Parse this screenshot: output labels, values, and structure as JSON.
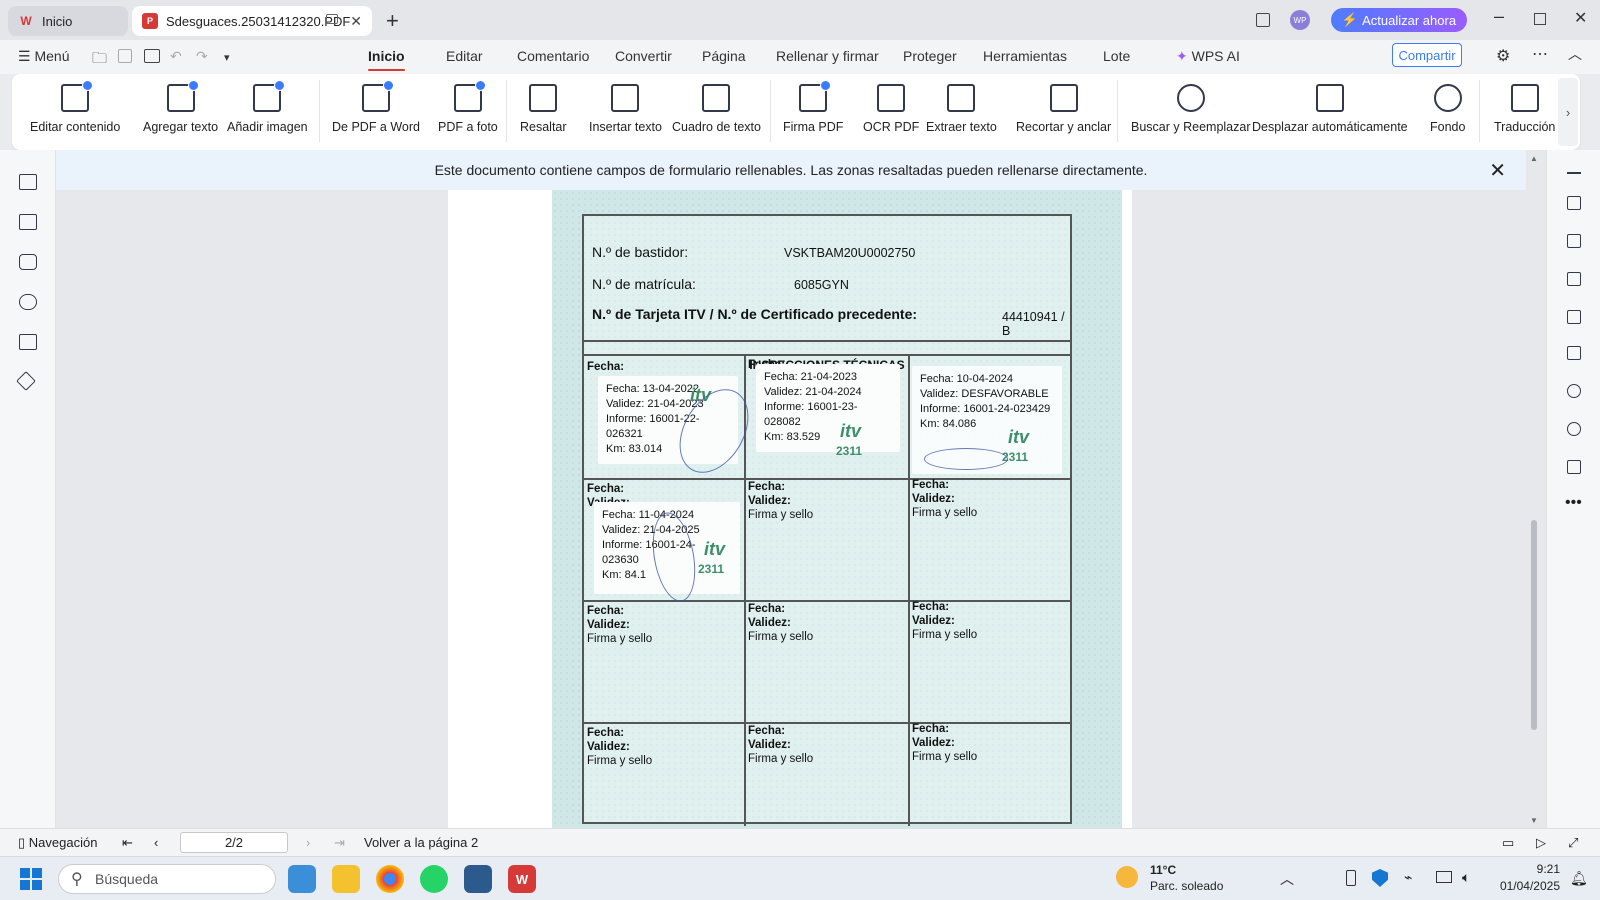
{
  "tabs": {
    "home": "Inicio",
    "document": "Sdesguaces.25031412320.PDF"
  },
  "titlebar": {
    "upgrade": "Actualizar ahora",
    "avatar": "WP"
  },
  "menubar": {
    "menu": "Menú",
    "items": [
      "Inicio",
      "Editar",
      "Comentario",
      "Convertir",
      "Página",
      "Rellenar y firmar",
      "Proteger",
      "Herramientas",
      "Lote"
    ],
    "wps_ai": "WPS AI",
    "share": "Compartir"
  },
  "ribbon": [
    "Editar contenido",
    "Agregar texto",
    "Añadir imagen",
    "De PDF a Word",
    "PDF a foto",
    "Resaltar",
    "Insertar texto",
    "Cuadro de texto",
    "Firma PDF",
    "OCR PDF",
    "Extraer texto",
    "Recortar y anclar",
    "Buscar y Reemplazar",
    "Desplazar automáticamente",
    "Fondo",
    "Traducción"
  ],
  "banner": "Este documento contiene campos de formulario rellenables. Las zonas resaltadas pueden rellenarse directamente.",
  "doc": {
    "bastidor_label": "N.º de bastidor:",
    "bastidor": "VSKTBAM20U0002750",
    "matricula_label": "N.º de matrícula:",
    "matricula": "6085GYN",
    "tarjeta_label": "N.º de Tarjeta ITV / N.º de Certificado precedente:",
    "tarjeta": "44410941 / B",
    "inspecciones": "INSPECCIONES TÉCNICAS",
    "fecha": "Fecha:",
    "validez": "Validez:",
    "firma": "Firma y sello",
    "stamps": [
      {
        "fecha": "Fecha:   13-04-2022",
        "validez": "Validez: 21-04-2023",
        "informe": "Informe: 16001-22-026321",
        "km": "Km: 83.014"
      },
      {
        "fecha": "Fecha:   21-04-2023",
        "validez": "Validez: 21-04-2024",
        "informe": "Informe: 16001-23-028082",
        "km": "Km: 83.529"
      },
      {
        "fecha": "Fecha:   10-04-2024",
        "validez": "Validez: DESFAVORABLE",
        "informe": "Informe: 16001-24-023429",
        "km": "Km: 84.086"
      },
      {
        "fecha": "Fecha:   11-04-2024",
        "validez": "Validez: 21-04-2025",
        "informe": "Informe: 16001-24-023630",
        "km": "Km: 84.1"
      }
    ],
    "itv": "itv",
    "itv_code": "2311"
  },
  "status": {
    "navigation": "Navegación",
    "page": "2/2",
    "back": "Volver a la página 2"
  },
  "taskbar": {
    "search": "Búsqueda",
    "temp": "11°C",
    "weather": "Parc. soleado",
    "time": "9:21",
    "date": "01/04/2025"
  },
  "colors": {
    "accent_red": "#d63a36",
    "accent_blue": "#3b7bff",
    "card_bg": "#cfe8e7"
  }
}
